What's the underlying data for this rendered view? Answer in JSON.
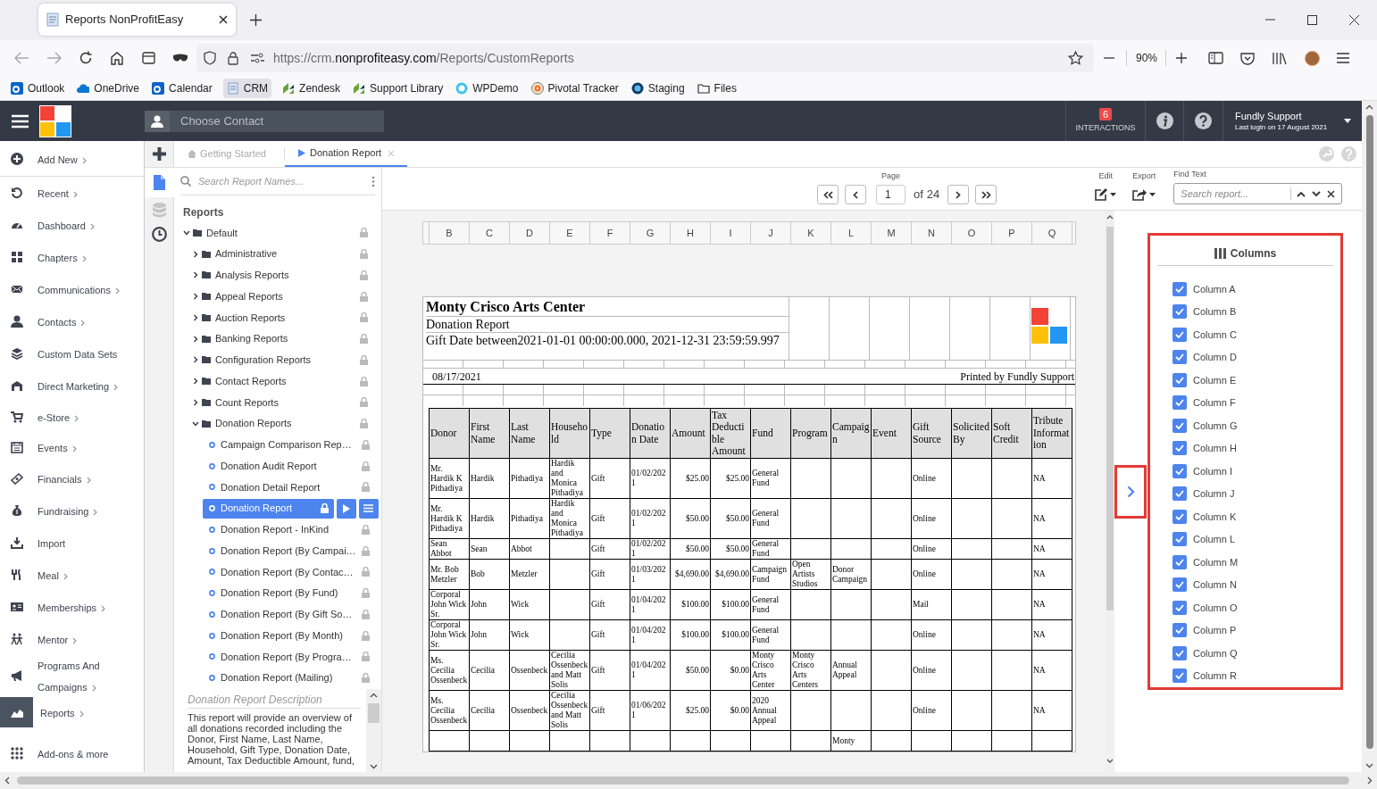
{
  "browser": {
    "tab_title": "Reports NonProfitEasy",
    "url_prefix": "https://crm.",
    "url_domain": "nonprofiteasy.com",
    "url_path": "/Reports/CustomReports",
    "zoom": "90%",
    "bookmarks": [
      {
        "label": "Outlook",
        "selected": false
      },
      {
        "label": "OneDrive",
        "selected": false
      },
      {
        "label": "Calendar",
        "selected": false
      },
      {
        "label": "CRM",
        "selected": true
      },
      {
        "label": "Zendesk",
        "selected": false
      },
      {
        "label": "Support Library",
        "selected": false
      },
      {
        "label": "WPDemo",
        "selected": false
      },
      {
        "label": "Pivotal Tracker",
        "selected": false
      },
      {
        "label": "Staging",
        "selected": false
      },
      {
        "label": "Files",
        "selected": false
      }
    ]
  },
  "header": {
    "contact_placeholder": "Choose Contact",
    "interactions_count": "6",
    "interactions_label": "INTERACTIONS",
    "user_name": "Fundly Support",
    "last_login": "Last login on 17 August 2021"
  },
  "sidebar": {
    "items": [
      {
        "label": "Add New",
        "has_arrow": true,
        "selected": false
      },
      {
        "label": "Recent",
        "has_arrow": true,
        "selected": false
      },
      {
        "label": "Dashboard",
        "has_arrow": true,
        "selected": false
      },
      {
        "label": "Chapters",
        "has_arrow": true,
        "selected": false
      },
      {
        "label": "Communications",
        "has_arrow": true,
        "selected": false
      },
      {
        "label": "Contacts",
        "has_arrow": true,
        "selected": false
      },
      {
        "label": "Custom Data Sets",
        "has_arrow": false,
        "selected": false
      },
      {
        "label": "Direct Marketing",
        "has_arrow": true,
        "selected": false
      },
      {
        "label": "e-Store",
        "has_arrow": true,
        "selected": false
      },
      {
        "label": "Events",
        "has_arrow": true,
        "selected": false
      },
      {
        "label": "Financials",
        "has_arrow": true,
        "selected": false
      },
      {
        "label": "Fundraising",
        "has_arrow": true,
        "selected": false
      },
      {
        "label": "Import",
        "has_arrow": false,
        "selected": false
      },
      {
        "label": "Meal",
        "has_arrow": true,
        "selected": false
      },
      {
        "label": "Memberships",
        "has_arrow": true,
        "selected": false
      },
      {
        "label": "Mentor",
        "has_arrow": true,
        "selected": false
      },
      {
        "label": "Programs And Campaigns",
        "has_arrow": true,
        "selected": false
      },
      {
        "label": "Reports",
        "has_arrow": true,
        "selected": true
      },
      {
        "label": "Add-ons & more",
        "has_arrow": false,
        "selected": false
      }
    ]
  },
  "tabs": [
    {
      "label": "Getting Started",
      "selected": false
    },
    {
      "label": "Donation Report",
      "selected": true
    }
  ],
  "tree": {
    "search_placeholder": "Search Report Names...",
    "heading": "Reports",
    "items": [
      {
        "label": "Default",
        "kind": "folder",
        "expanded": true,
        "children": [
          {
            "label": "Administrative",
            "kind": "folder",
            "expanded": false
          },
          {
            "label": "Analysis Reports",
            "kind": "folder",
            "expanded": false
          },
          {
            "label": "Appeal Reports",
            "kind": "folder",
            "expanded": false
          },
          {
            "label": "Auction Reports",
            "kind": "folder",
            "expanded": false
          },
          {
            "label": "Banking Reports",
            "kind": "folder",
            "expanded": false
          },
          {
            "label": "Configuration Reports",
            "kind": "folder",
            "expanded": false
          },
          {
            "label": "Contact Reports",
            "kind": "folder",
            "expanded": false
          },
          {
            "label": "Count Reports",
            "kind": "folder",
            "expanded": false
          },
          {
            "label": "Donation Reports",
            "kind": "folder",
            "expanded": true,
            "children": [
              {
                "label": "Campaign Comparison Rep…",
                "kind": "report",
                "selected": false
              },
              {
                "label": "Donation Audit Report",
                "kind": "report",
                "selected": false
              },
              {
                "label": "Donation Detail Report",
                "kind": "report",
                "selected": false
              },
              {
                "label": "Donation Report",
                "kind": "report",
                "selected": true
              },
              {
                "label": "Donation Report - InKind",
                "kind": "report",
                "selected": false
              },
              {
                "label": "Donation Report (By Campai…",
                "kind": "report",
                "selected": false
              },
              {
                "label": "Donation Report (By Contac…",
                "kind": "report",
                "selected": false
              },
              {
                "label": "Donation Report (By Fund)",
                "kind": "report",
                "selected": false
              },
              {
                "label": "Donation Report (By Gift So…",
                "kind": "report",
                "selected": false
              },
              {
                "label": "Donation Report (By Month)",
                "kind": "report",
                "selected": false
              },
              {
                "label": "Donation Report (By Progra…",
                "kind": "report",
                "selected": false
              },
              {
                "label": "Donation Report (Mailing)",
                "kind": "report",
                "selected": false
              }
            ]
          }
        ]
      }
    ]
  },
  "description": {
    "title": "Donation Report Description",
    "text": "This report will provide an overview of all donations recorded including the Donor, First Name, Last Name, Household, Gift Type, Donation Date, Amount, Tax Deductible Amount, fund,"
  },
  "pager": {
    "label": "Page",
    "page": "1",
    "of": "of",
    "total": "24"
  },
  "toolbar": {
    "edit_label": "Edit",
    "export_label": "Export",
    "find_label": "Find Text",
    "find_placeholder": "Search report..."
  },
  "report": {
    "column_letters": [
      "B",
      "C",
      "D",
      "E",
      "F",
      "G",
      "H",
      "I",
      "J",
      "K",
      "L",
      "M",
      "N",
      "O",
      "P",
      "Q"
    ],
    "title": "Monty Crisco Arts Center",
    "subtitle": "Donation Report",
    "filter": "Gift Date between2021-01-01 00:00:00.000, 2021-12-31 23:59:59.997",
    "date": "08/17/2021",
    "printed_by": "Printed by Fundly Support",
    "columns": [
      "Donor",
      "First Name",
      "Last Name",
      "Household",
      "Type",
      "Donation Date",
      "Amount",
      "Tax Deductible Amount",
      "Fund",
      "Program",
      "Campaign",
      "Event",
      "Gift Source",
      "Solicited By",
      "Soft Credit",
      "Tribute Information"
    ],
    "rows": [
      [
        "Mr. Hardik K Pithadiya",
        "Hardik",
        "Pithadiya",
        "Hardik and Monica Pithadiya",
        "Gift",
        "01/02/2021",
        "$25.00",
        "$25.00",
        "General Fund",
        "",
        "",
        "",
        "Online",
        "",
        "",
        "NA"
      ],
      [
        "Mr. Hardik K Pithadiya",
        "Hardik",
        "Pithadiya",
        "Hardik and Monica Pithadiya",
        "Gift",
        "01/02/2021",
        "$50.00",
        "$50.00",
        "General Fund",
        "",
        "",
        "",
        "Online",
        "",
        "",
        "NA"
      ],
      [
        "Sean Abbot",
        "Sean",
        "Abbot",
        "",
        "Gift",
        "01/02/2021",
        "$50.00",
        "$50.00",
        "General Fund",
        "",
        "",
        "",
        "Online",
        "",
        "",
        "NA"
      ],
      [
        "Mr. Bob Metzler",
        "Bob",
        "Metzler",
        "",
        "Gift",
        "01/03/2021",
        "$4,690.00",
        "$4,690.00",
        "Campaign Fund",
        "Open Artists Studios",
        "Donor Campaign",
        "",
        "Online",
        "",
        "",
        "NA"
      ],
      [
        "Corporal John Wick Sr.",
        "John",
        "Wick",
        "",
        "Gift",
        "01/04/2021",
        "$100.00",
        "$100.00",
        "General Fund",
        "",
        "",
        "",
        "Mail",
        "",
        "",
        "NA"
      ],
      [
        "Corporal John Wick Sr.",
        "John",
        "Wick",
        "",
        "Gift",
        "01/04/2021",
        "$100.00",
        "$100.00",
        "General Fund",
        "",
        "",
        "",
        "Online",
        "",
        "",
        "NA"
      ],
      [
        "Ms. Cecilia Ossenbeck",
        "Cecilia",
        "Ossenbeck",
        "Cecilia Ossenbeck and Matt Solis",
        "Gift",
        "01/04/2021",
        "$50.00",
        "$0.00",
        "Monty Crisco Arts Center",
        "Monty Crisco Arts Centers",
        "Annual Appeal",
        "",
        "Online",
        "",
        "",
        "NA"
      ],
      [
        "Ms. Cecilia Ossenbeck",
        "Cecilia",
        "Ossenbeck",
        "Cecilia Ossenbeck and Matt Solis",
        "Gift",
        "01/06/2021",
        "$25.00",
        "$0.00",
        "2020 Annual Appeal",
        "",
        "",
        "",
        "Online",
        "",
        "",
        "NA"
      ],
      [
        "",
        "",
        "",
        "",
        "",
        "",
        "",
        "",
        "",
        "",
        "Monty",
        "",
        "",
        "",
        "",
        ""
      ]
    ]
  },
  "columns_panel": {
    "title": "Columns",
    "items": [
      {
        "label": "Column A",
        "checked": true
      },
      {
        "label": "Column B",
        "checked": true
      },
      {
        "label": "Column C",
        "checked": true
      },
      {
        "label": "Column D",
        "checked": true
      },
      {
        "label": "Column E",
        "checked": true
      },
      {
        "label": "Column F",
        "checked": true
      },
      {
        "label": "Column G",
        "checked": true
      },
      {
        "label": "Column H",
        "checked": true
      },
      {
        "label": "Column I",
        "checked": true
      },
      {
        "label": "Column J",
        "checked": true
      },
      {
        "label": "Column K",
        "checked": true
      },
      {
        "label": "Column L",
        "checked": true
      },
      {
        "label": "Column M",
        "checked": true
      },
      {
        "label": "Column N",
        "checked": true
      },
      {
        "label": "Column O",
        "checked": true
      },
      {
        "label": "Column P",
        "checked": true
      },
      {
        "label": "Column Q",
        "checked": true
      },
      {
        "label": "Column R",
        "checked": true
      }
    ]
  }
}
